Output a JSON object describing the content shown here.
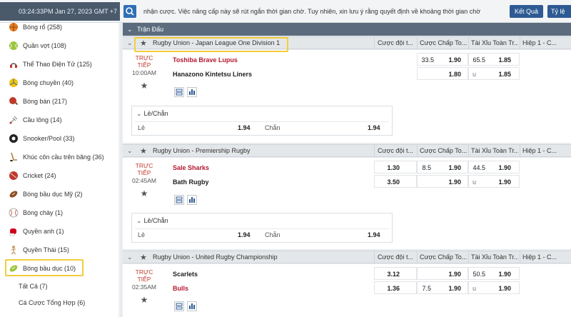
{
  "header": {
    "datetime": "03:24:33PM Jan 27, 2023 GMT +7",
    "marquee": "nhận cược. Việc nâng cấp này sẽ rút ngắn thời gian chờ. Tuy nhiên, xin lưu ý rằng quyết định về khoảng thời gian chờ",
    "results_btn": "Kết Quả",
    "odds_btn": "Tỷ lệ"
  },
  "sidebar": {
    "items": [
      {
        "label": "Bóng rổ (258)",
        "icon": "basketball-icon",
        "color": "#e67e22"
      },
      {
        "label": "Quần vợt (108)",
        "icon": "tennis-icon",
        "color": "#9bc53d"
      },
      {
        "label": "Thể Thao Điện Tử (125)",
        "icon": "esports-icon",
        "color": "#555555"
      },
      {
        "label": "Bóng chuyền (40)",
        "icon": "volleyball-icon",
        "color": "#f1c40f"
      },
      {
        "label": "Bóng bàn (217)",
        "icon": "table-tennis-icon",
        "color": "#c0392b"
      },
      {
        "label": "Cầu lông (14)",
        "icon": "badminton-icon",
        "color": "#888888"
      },
      {
        "label": "Snooker/Pool (33)",
        "icon": "snooker-icon",
        "color": "#222222"
      },
      {
        "label": "Khúc côn cầu trên băng (36)",
        "icon": "ice-hockey-icon",
        "color": "#b08040"
      },
      {
        "label": "Cricket (24)",
        "icon": "cricket-icon",
        "color": "#c0392b"
      },
      {
        "label": "Bóng bầu dục Mỹ (2)",
        "icon": "american-football-icon",
        "color": "#8e4a1c"
      },
      {
        "label": "Bóng chày (1)",
        "icon": "baseball-icon",
        "color": "#aaaaaa"
      },
      {
        "label": "Quyền anh (1)",
        "icon": "boxing-icon",
        "color": "#d0021b"
      },
      {
        "label": "Quyền Thái (15)",
        "icon": "muay-thai-icon",
        "color": "#c8a165"
      },
      {
        "label": "Bóng bầu dục (10)",
        "icon": "rugby-icon",
        "color": "#9bc53d"
      }
    ],
    "subitems": [
      "Tất Cả (7)",
      "Cá Cược Tổng Hợp (6)"
    ]
  },
  "main": {
    "section_title": "Trận Đấu",
    "columns": [
      "Cược đội t...",
      "Cược Chấp To...",
      "Tài Xỉu Toàn Tr...",
      "Hiệp 1 - C..."
    ],
    "leagues": [
      {
        "name": "Rugby Union - Japan League One Division 1",
        "live_label": "TRỰC TIẾP",
        "time": "10:00AM",
        "home": "Toshiba Brave Lupus",
        "away": "Hanazono Kintetsu Liners",
        "hc_home_line": "33.5",
        "hc_home_odds": "1.90",
        "hc_away_odds": "1.80",
        "ou_line": "65.5",
        "ou_over": "1.85",
        "ou_under_label": "u",
        "ou_under": "1.85",
        "oe_title": "Lẻ/Chẵn",
        "odd_label": "Lẻ",
        "odd_val": "1.94",
        "even_label": "Chẵn",
        "even_val": "1.94"
      },
      {
        "name": "Rugby Union - Premiership Rugby",
        "live_label": "TRỰC TIẾP",
        "time": "02:45AM",
        "home": "Sale Sharks",
        "away": "Bath Rugby",
        "ml_home": "1.30",
        "ml_away": "3.50",
        "hc_home_line": "8.5",
        "hc_home_odds": "1.90",
        "hc_away_odds": "1.90",
        "ou_line": "44.5",
        "ou_over": "1.90",
        "ou_under_label": "u",
        "ou_under": "1.90",
        "oe_title": "Lẻ/Chẵn",
        "odd_label": "Lẻ",
        "odd_val": "1.94",
        "even_label": "Chẵn",
        "even_val": "1.94"
      },
      {
        "name": "Rugby Union - United Rugby Championship",
        "live_label": "TRỰC TIẾP",
        "time": "02:35AM",
        "home": "Scarlets",
        "away": "Bulls",
        "ml_home": "3.12",
        "ml_away": "1.36",
        "hc_home_odds": "1.90",
        "hc_away_line": "7.5",
        "hc_away_odds": "1.90",
        "ou_line": "50.5",
        "ou_over": "1.90",
        "ou_under_label": "u",
        "ou_under": "1.90"
      }
    ]
  }
}
